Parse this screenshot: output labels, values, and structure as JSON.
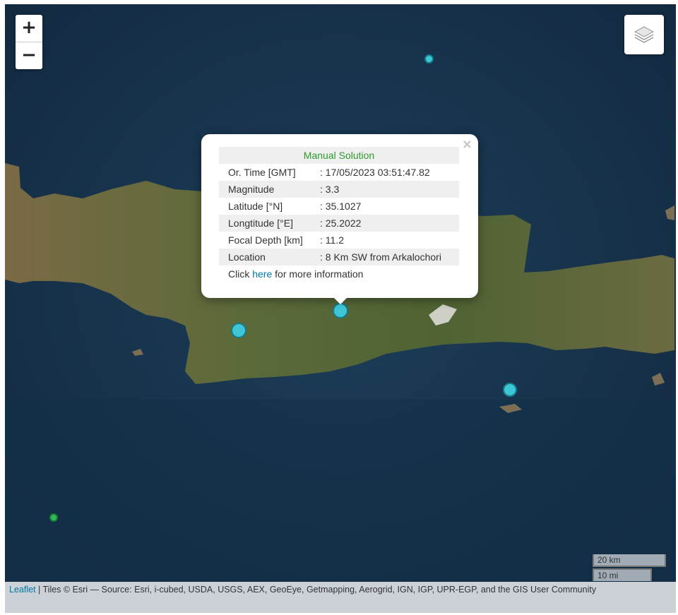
{
  "map": {
    "zoom_in": "+",
    "zoom_out": "−",
    "layers_icon": "layers-icon"
  },
  "popup": {
    "title": "Manual Solution",
    "close": "×",
    "rows": [
      {
        "label": "Or. Time [GMT]",
        "value": ": 17/05/2023 03:51:47.82"
      },
      {
        "label": "Magnitude",
        "value": ": 3.3"
      },
      {
        "label": "Latitude [°N]",
        "value": ": 35.1027"
      },
      {
        "label": "Longtitude [°E]",
        "value": ": 25.2022"
      },
      {
        "label": "Focal Depth [km]",
        "value": ": 11.2"
      },
      {
        "label": "Location",
        "value": ": 8 Km SW from Arkalochori"
      }
    ],
    "more_prefix": "Click ",
    "more_link": "here",
    "more_suffix": " for more information"
  },
  "scale": {
    "km": "20 km",
    "mi": "10 mi"
  },
  "attribution": {
    "leaflet": "Leaflet",
    "text": " | Tiles © Esri — Source: Esri, i-cubed, USDA, USGS, AEX, GeoEye, Getmapping, Aerogrid, IGN, IGP, UPR-EGP, and the GIS User Community"
  },
  "colors": {
    "sea": "#17344f",
    "land": "#5b6a3a",
    "quake_marker": "#3ec6d6",
    "quake_marker_small_green": "#33b85a",
    "popup_title": "#2d9a2d",
    "link": "#0078a8"
  }
}
